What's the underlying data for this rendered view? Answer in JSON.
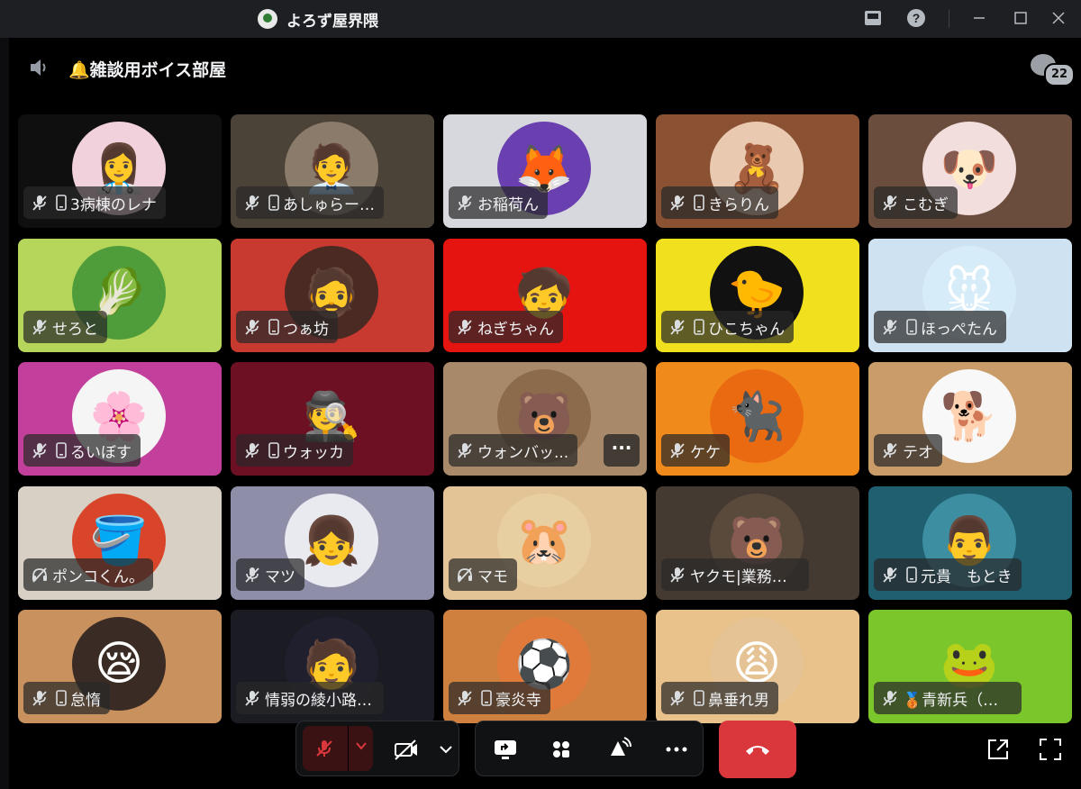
{
  "titlebar": {
    "server_name": "よろず屋界隈",
    "icons": [
      "inbox-icon",
      "help-icon",
      "minimize-icon",
      "maximize-icon",
      "close-icon"
    ]
  },
  "channel": {
    "name": "🔔雑談用ボイス部屋",
    "chat_count": "22"
  },
  "participants": [
    {
      "name": "3病棟のレナ",
      "bg": "#0f0f0f",
      "avatar": "#f1d1dc",
      "glyph": "👩‍⚕️",
      "phone": true
    },
    {
      "name": "あしゅらーMa...",
      "bg": "#4b4337",
      "avatar": "#8a7b6a",
      "glyph": "🧑‍💼",
      "phone": true
    },
    {
      "name": "お稲荷ん",
      "bg": "#d7d8de",
      "avatar": "#6a3fb0",
      "glyph": "🦊",
      "phone": false
    },
    {
      "name": "きらりん",
      "bg": "#8a5232",
      "avatar": "#e9c9b0",
      "glyph": "🧸",
      "phone": true
    },
    {
      "name": "こむぎ",
      "bg": "#6a4d3c",
      "avatar": "#f3dede",
      "glyph": "🐶",
      "phone": false
    },
    {
      "name": "せろと",
      "bg": "#b5d65a",
      "avatar": "#4f9c3a",
      "glyph": "🥬",
      "phone": false
    },
    {
      "name": "つぁ坊",
      "bg": "#c8392f",
      "avatar": "#4a2a22",
      "glyph": "🧔",
      "phone": true
    },
    {
      "name": "ねぎちゃん",
      "bg": "#e51410",
      "avatar": "#e51410",
      "glyph": "🧒",
      "phone": false
    },
    {
      "name": "ひこちゃん",
      "bg": "#f1e01e",
      "avatar": "#111111",
      "glyph": "🐤",
      "phone": true
    },
    {
      "name": "ほっぺたん",
      "bg": "#cfe2f2",
      "avatar": "#d6ecf8",
      "glyph": "🐭",
      "phone": true
    },
    {
      "name": "るいぼす",
      "bg": "#c2409c",
      "avatar": "#f5f5f5",
      "glyph": "🌸",
      "phone": true
    },
    {
      "name": "ウォッカ",
      "bg": "#6d1024",
      "avatar": "#6d1024",
      "glyph": "🕵️",
      "phone": true
    },
    {
      "name": "ウォンバッ...",
      "bg": "#a88a6a",
      "avatar": "#8b6b4c",
      "glyph": "🐻",
      "phone": false,
      "more": "···"
    },
    {
      "name": "ケケ",
      "bg": "#f08a1a",
      "avatar": "#ea6a12",
      "glyph": "🐈‍⬛",
      "phone": false
    },
    {
      "name": "テオ",
      "bg": "#c99c6a",
      "avatar": "#f8f8f8",
      "glyph": "🐕",
      "phone": false
    },
    {
      "name": "ポンコくん。",
      "bg": "#d8d0c4",
      "avatar": "#d8452a",
      "glyph": "🪣",
      "phone": false,
      "muted_off": true
    },
    {
      "name": "マツ",
      "bg": "#8e8ea8",
      "avatar": "#e9e9f0",
      "glyph": "👧",
      "phone": false
    },
    {
      "name": "マモ",
      "bg": "#e2c496",
      "avatar": "#e8cfa2",
      "glyph": "🐹",
      "phone": false,
      "muted_off": true
    },
    {
      "name": "ヤクモ|業務用ス...",
      "bg": "#453a31",
      "avatar": "#5a4a3c",
      "glyph": "🐻",
      "phone": false
    },
    {
      "name": "元貴　もとき",
      "bg": "#1f5f6f",
      "avatar": "#3c8ea0",
      "glyph": "👨",
      "phone": true
    },
    {
      "name": "怠惰",
      "bg": "#c8915e",
      "avatar": "#3a2c24",
      "glyph": "😪",
      "phone": true
    },
    {
      "name": "情弱の綾小路（...",
      "bg": "#1b1b24",
      "avatar": "#1f1f2e",
      "glyph": "🧑",
      "phone": false
    },
    {
      "name": "豪炎寺",
      "bg": "#d0803e",
      "avatar": "#e07a3a",
      "glyph": "⚽",
      "phone": true
    },
    {
      "name": "鼻垂れ男",
      "bg": "#e9c18a",
      "avatar": "#e6c394",
      "glyph": "😩",
      "phone": true
    },
    {
      "name": "🥉青新兵（あお...",
      "bg": "#7bc62a",
      "avatar": "#7bc62a",
      "glyph": "🐸",
      "phone": false
    }
  ],
  "controls": {
    "mute": "microphone-muted-icon",
    "camera": "camera-off-icon",
    "share": "screen-share-icon",
    "activities": "activities-icon",
    "soundboard": "soundboard-icon",
    "more": "more-icon",
    "hangup": "hangup-icon",
    "popout": "popout-icon",
    "fullscreen": "fullscreen-icon"
  }
}
